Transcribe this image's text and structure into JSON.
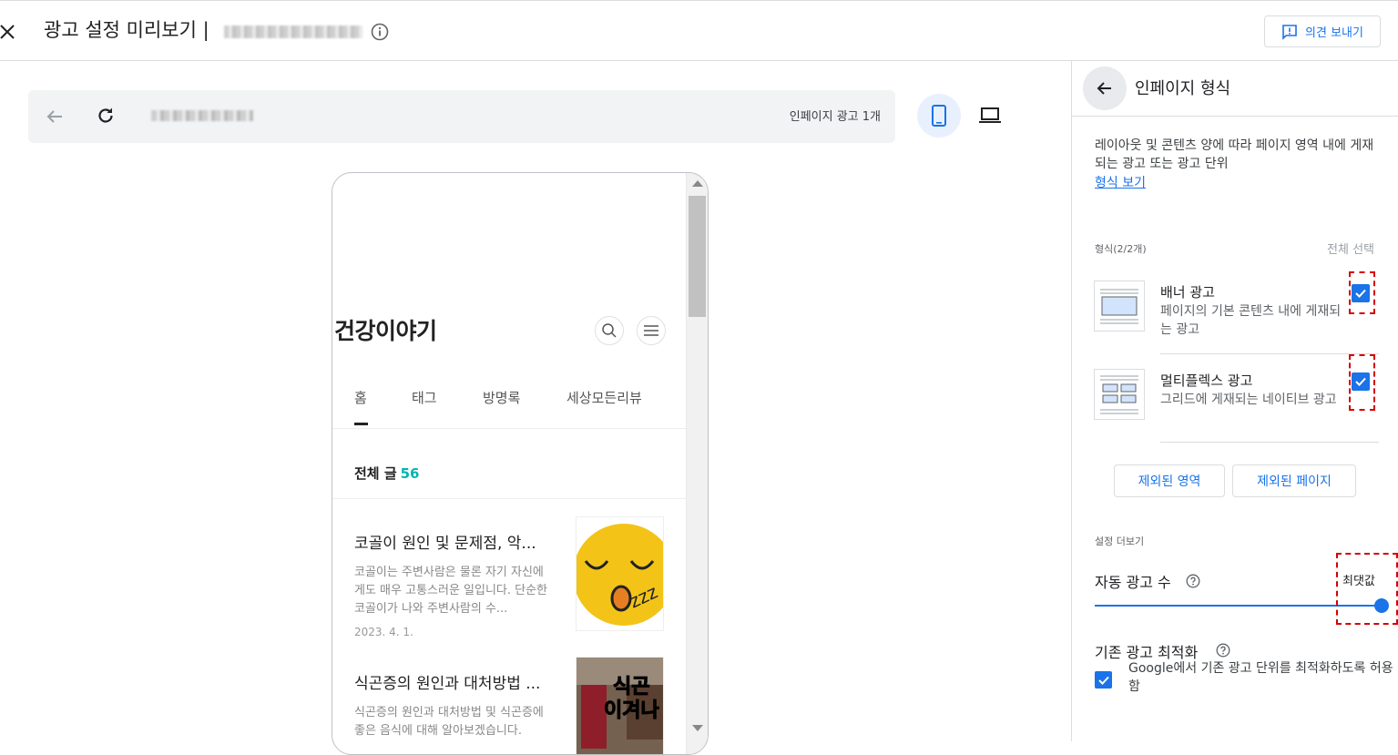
{
  "header": {
    "title": "광고 설정 미리보기 |",
    "feedback_label": "의견 보내기"
  },
  "browser": {
    "ad_count_label": "인페이지 광고 1개"
  },
  "blog": {
    "title": "건강이야기",
    "nav": [
      "홈",
      "태그",
      "방명록",
      "세상모든리뷰"
    ],
    "all_posts_label": "전체 글",
    "all_posts_count": "56",
    "posts": [
      {
        "title": "코골이 원인 및 문제점, 악...",
        "excerpt": "코골이는 주변사람은 물론 자기 자신에게도 매우 고통스러운 일입니다. 단순한 코골이가 나와 주변사람의 수...",
        "date": "2023. 4. 1."
      },
      {
        "title": "식곤증의 원인과 대처방법 ...",
        "excerpt": "식곤증의 원인과 대처방법 및 식곤증에 좋은 음식에 대해 알아보겠습니다.",
        "date": "",
        "thumb_text": [
          "식곤",
          "이겨나"
        ]
      }
    ]
  },
  "panel": {
    "title": "인페이지 형식",
    "description": "레이아웃 및 콘텐츠 양에 따라 페이지 영역 내에 게재되는 광고 또는 광고 단위",
    "link": "형식 보기",
    "format_label": "형식(2/2개)",
    "select_all": "전체 선택",
    "formats": [
      {
        "title": "배너 광고",
        "desc": "페이지의 기본 콘텐츠 내에 게재되는 광고",
        "checked": true
      },
      {
        "title": "멀티플렉스 광고",
        "desc": "그리드에 게재되는 네이티브 광고",
        "checked": true
      }
    ],
    "excluded_areas": "제외된 영역",
    "excluded_pages": "제외된 페이지",
    "more_settings": "설정 더보기",
    "auto_ad_count": "자동 광고 수",
    "max_label": "최댓값",
    "slider_value": 1.0,
    "optimize_title": "기존 광고 최적화",
    "optimize_desc": "Google에서 기존 광고 단위를 최적화하도록 허용함",
    "optimize_checked": true
  },
  "colors": {
    "accent": "#1a73e8",
    "annotation": "#d50000",
    "teal": "#00b4b4"
  }
}
